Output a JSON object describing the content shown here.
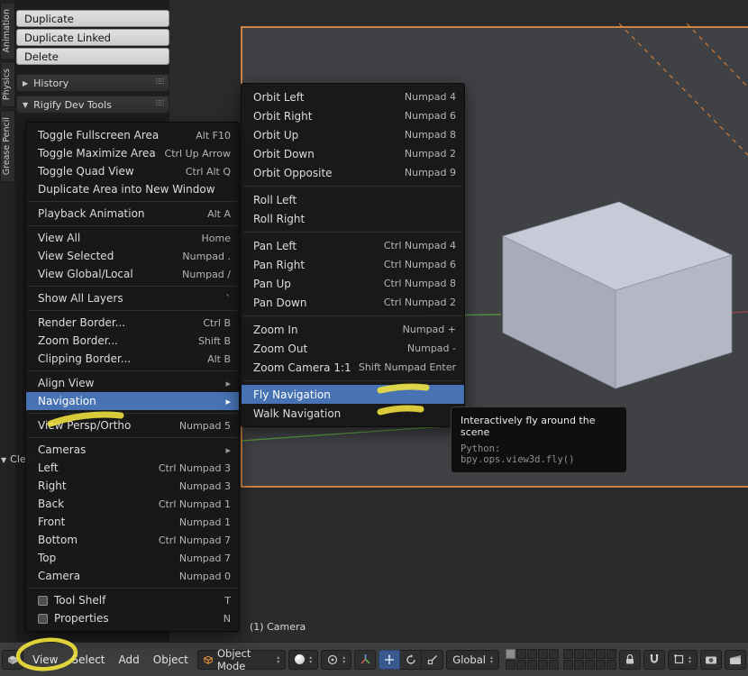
{
  "colors": {
    "accent_blue": "#4772b3",
    "annotation_yellow": "#f2e33c",
    "camera_border_orange": "#ff9d45",
    "axis_green": "#5a9e3e",
    "axis_red": "#a04545"
  },
  "icons": {
    "submenu_arrow": "▸",
    "tri_up": "▴",
    "tri_down": "▾",
    "panel_grip": "⠿⠿"
  },
  "side_tabs": [
    {
      "label": "Animation"
    },
    {
      "label": "Physics"
    },
    {
      "label": "Grease Pencil"
    }
  ],
  "context_menu": {
    "items": [
      {
        "label": "Duplicate"
      },
      {
        "label": "Duplicate Linked"
      },
      {
        "label": "Delete"
      }
    ]
  },
  "tool_panels": [
    {
      "arrow": "▶",
      "label": "History"
    },
    {
      "arrow": "▼",
      "label": "Rigify Dev Tools"
    }
  ],
  "clear_panel": {
    "arrow": "▼",
    "label": "Clear Ro"
  },
  "view_menu": {
    "items": [
      {
        "label": "Toggle Fullscreen Area",
        "shortcut": "Alt F10"
      },
      {
        "label": "Toggle Maximize Area",
        "shortcut": "Ctrl Up Arrow"
      },
      {
        "label": "Toggle Quad View",
        "shortcut": "Ctrl Alt Q"
      },
      {
        "label": "Duplicate Area into New Window"
      },
      {
        "sep": true
      },
      {
        "label": "Playback Animation",
        "shortcut": "Alt A"
      },
      {
        "sep": true
      },
      {
        "label": "View All",
        "shortcut": "Home"
      },
      {
        "label": "View Selected",
        "shortcut": "Numpad ."
      },
      {
        "label": "View Global/Local",
        "shortcut": "Numpad /"
      },
      {
        "sep": true
      },
      {
        "label": "Show All Layers",
        "shortcut": "`"
      },
      {
        "sep": true
      },
      {
        "label": "Render Border...",
        "shortcut": "Ctrl B"
      },
      {
        "label": "Zoom Border...",
        "shortcut": "Shift B"
      },
      {
        "label": "Clipping Border...",
        "shortcut": "Alt B"
      },
      {
        "sep": true
      },
      {
        "label": "Align View",
        "submenu": true
      },
      {
        "label": "Navigation",
        "submenu": true,
        "highlighted": true
      },
      {
        "sep": true
      },
      {
        "label": "View Persp/Ortho",
        "shortcut": "Numpad 5"
      },
      {
        "sep": true
      },
      {
        "label": "Cameras",
        "submenu": true
      },
      {
        "label": "Left",
        "shortcut": "Ctrl Numpad 3"
      },
      {
        "label": "Right",
        "shortcut": "Numpad 3"
      },
      {
        "label": "Back",
        "shortcut": "Ctrl Numpad 1"
      },
      {
        "label": "Front",
        "shortcut": "Numpad 1"
      },
      {
        "label": "Bottom",
        "shortcut": "Ctrl Numpad 7"
      },
      {
        "label": "Top",
        "shortcut": "Numpad 7"
      },
      {
        "label": "Camera",
        "shortcut": "Numpad 0"
      },
      {
        "sep": true
      },
      {
        "label": "Tool Shelf",
        "shortcut": "T",
        "checkbox": true
      },
      {
        "label": "Properties",
        "shortcut": "N",
        "checkbox": true
      }
    ]
  },
  "nav_submenu": {
    "items": [
      {
        "label": "Orbit Left",
        "shortcut": "Numpad 4"
      },
      {
        "label": "Orbit Right",
        "shortcut": "Numpad 6"
      },
      {
        "label": "Orbit Up",
        "shortcut": "Numpad 8"
      },
      {
        "label": "Orbit Down",
        "shortcut": "Numpad 2"
      },
      {
        "label": "Orbit Opposite",
        "shortcut": "Numpad 9"
      },
      {
        "sep": true
      },
      {
        "label": "Roll Left"
      },
      {
        "label": "Roll Right"
      },
      {
        "sep": true
      },
      {
        "label": "Pan Left",
        "shortcut": "Ctrl Numpad 4"
      },
      {
        "label": "Pan Right",
        "shortcut": "Ctrl Numpad 6"
      },
      {
        "label": "Pan Up",
        "shortcut": "Ctrl Numpad 8"
      },
      {
        "label": "Pan Down",
        "shortcut": "Ctrl Numpad 2"
      },
      {
        "sep": true
      },
      {
        "label": "Zoom In",
        "shortcut": "Numpad +"
      },
      {
        "label": "Zoom Out",
        "shortcut": "Numpad -"
      },
      {
        "label": "Zoom Camera 1:1",
        "shortcut": "Shift Numpad Enter"
      },
      {
        "sep": true
      },
      {
        "label": "Fly Navigation",
        "highlighted": true
      },
      {
        "label": "Walk Navigation"
      }
    ]
  },
  "tooltip": {
    "line1": "Interactively fly around the scene",
    "line2": "Python: bpy.ops.view3d.fly()"
  },
  "viewport": {
    "camera_label": "(1) Camera"
  },
  "header": {
    "menus": [
      {
        "label": "View"
      },
      {
        "label": "Select"
      },
      {
        "label": "Add"
      },
      {
        "label": "Object"
      }
    ],
    "mode_label": "Object Mode",
    "orientation_label": "Global"
  }
}
